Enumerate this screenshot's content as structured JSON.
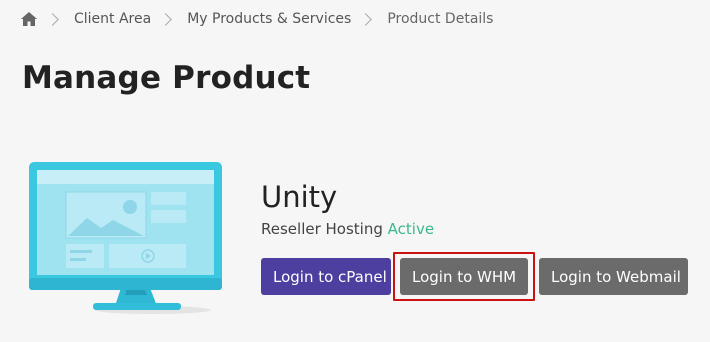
{
  "breadcrumb": {
    "home_icon": "home-icon",
    "items": [
      "Client Area",
      "My Products & Services"
    ],
    "current": "Product Details"
  },
  "page": {
    "title": "Manage Product"
  },
  "product": {
    "name": "Unity",
    "type": "Reseller Hosting",
    "status": "Active",
    "illustration_icon": "monitor-illustration"
  },
  "actions": {
    "cpanel_label": "Login to cPanel",
    "whm_label": "Login to WHM",
    "webmail_label": "Login to Webmail"
  },
  "colors": {
    "background": "#f6f6f6",
    "primary_button": "#4d3fa0",
    "secondary_button": "#6b6b6b",
    "status_active": "#3cb88a",
    "highlight": "#cc1111",
    "monitor_frame": "#3ac7e0"
  }
}
